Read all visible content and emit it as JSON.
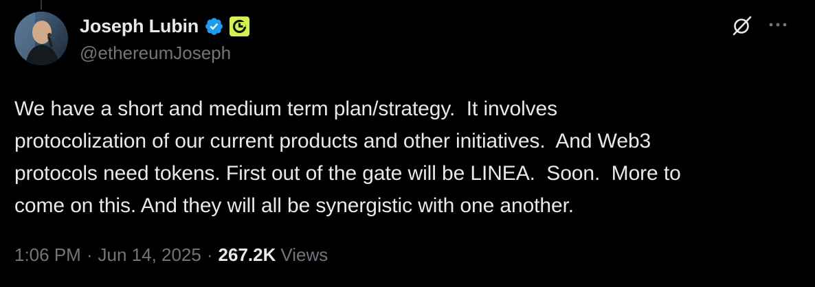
{
  "tweet": {
    "author": {
      "display_name": "Joseph Lubin",
      "handle": "@ethereumJoseph",
      "verified": true,
      "verified_color": "#1d9bf0",
      "affiliate_badge_color": "#d4f24a"
    },
    "text": "We have a short and medium term plan/strategy.  It involves protocolization of our current products and other initiatives.  And Web3 protocols need tokens. First out of the gate will be LINEA.  Soon.  More to come on this. And they will all be synergistic with one another.",
    "text_lines": [
      "We have a short and medium term plan/strategy.  It involves",
      "protocolization of our current products and other initiatives.  And Web3",
      "protocols need tokens. First out of the gate will be LINEA.  Soon.  More to",
      "come on this. And they will all be synergistic with one another."
    ],
    "time": "1:06 PM",
    "date": "Jun 14, 2025",
    "separator": "·",
    "views_count": "267.2K",
    "views_label": "Views"
  },
  "icons": {
    "verified": "verified-badge-icon",
    "affiliate": "affiliate-logo-icon",
    "grok": "grok-icon",
    "more": "more-options-icon"
  },
  "colors": {
    "background": "#000000",
    "primary_text": "#e7e9ea",
    "secondary_text": "#71767b",
    "accent": "#1d9bf0"
  }
}
